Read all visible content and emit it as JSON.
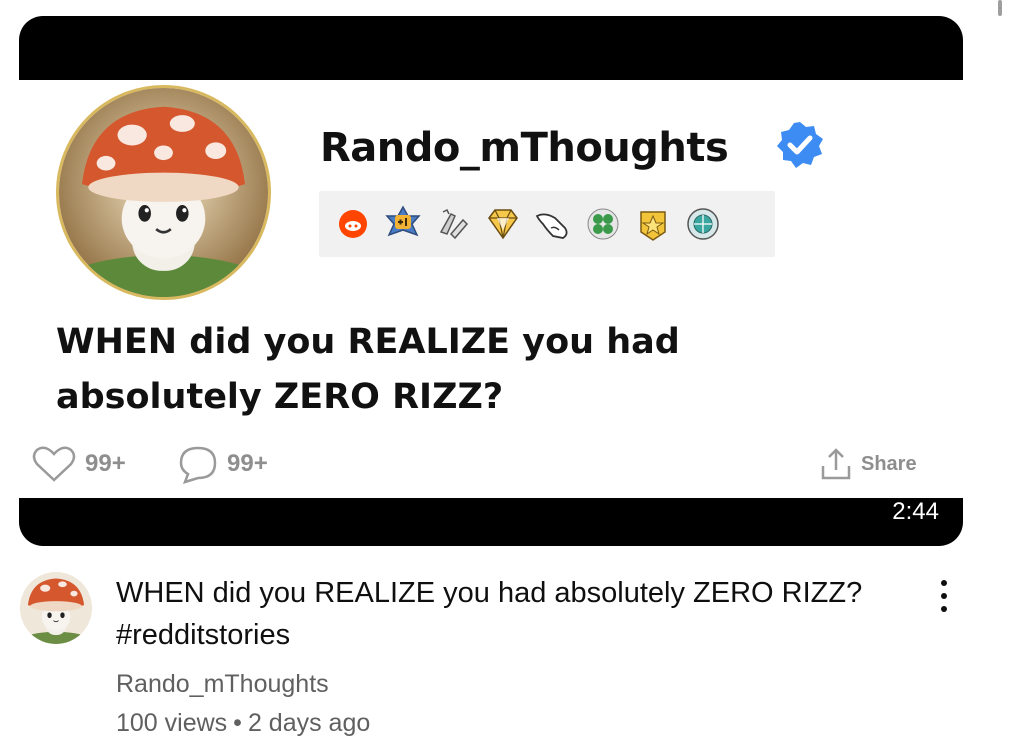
{
  "thumbnail": {
    "author": "Rando_mThoughts",
    "post_title": "WHEN did you REALIZE you had absolutely ZERO RIZZ?",
    "likes": "99+",
    "comments": "99+",
    "share_label": "Share",
    "duration": "2:44",
    "badges": [
      "reddit-icon",
      "plus-one-award-icon",
      "helpful-award-icon",
      "gem-award-icon",
      "pointing-hand-icon",
      "clover-award-icon",
      "star-award-icon",
      "globe-award-icon"
    ]
  },
  "video": {
    "title": "WHEN did you REALIZE you had absolutely ZERO RIZZ? #redditstories",
    "channel": "Rando_mThoughts",
    "views": "100 views",
    "separator": "•",
    "age": "2 days ago"
  },
  "colors": {
    "verified": "#3c8cf3",
    "text_secondary": "#606060",
    "frame": "#000000"
  }
}
